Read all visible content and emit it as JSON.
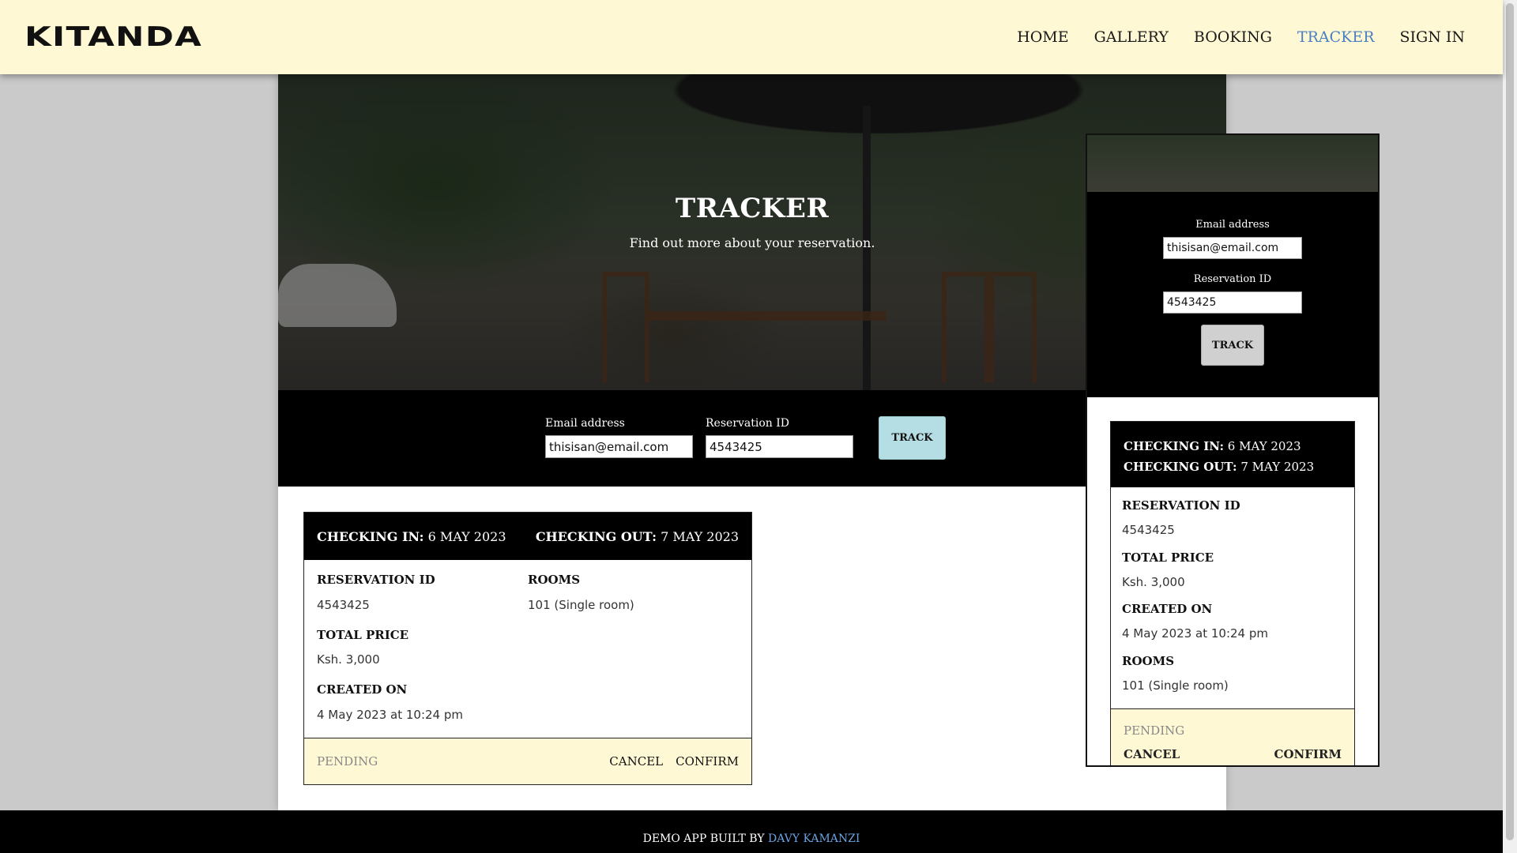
{
  "header": {
    "logo": "KITANDA",
    "nav": [
      {
        "label": "HOME",
        "active": false
      },
      {
        "label": "GALLERY",
        "active": false
      },
      {
        "label": "BOOKING",
        "active": false
      },
      {
        "label": "TRACKER",
        "active": true
      },
      {
        "label": "SIGN IN",
        "active": false
      }
    ],
    "active_color": "#4a7fc1"
  },
  "hero": {
    "title": "TRACKER",
    "subtitle": "Find out more about your reservation."
  },
  "search": {
    "email_label": "Email address",
    "email_value": "thisisan@email.com",
    "reservation_label": "Reservation ID",
    "reservation_value": "4543425",
    "track_label": "TRACK",
    "track_color": "#b4dee4"
  },
  "reservation": {
    "checking_in_label": "CHECKING IN:",
    "checking_in_value": "6 MAY 2023",
    "checking_out_label": "CHECKING OUT:",
    "checking_out_value": "7 MAY 2023",
    "reservation_id_label": "RESERVATION ID",
    "reservation_id_value": "4543425",
    "rooms_label": "ROOMS",
    "rooms_value": "101 (Single room)",
    "total_price_label": "TOTAL PRICE",
    "total_price_value": "Ksh. 3,000",
    "created_on_label": "CREATED ON",
    "created_on_value": "4 May 2023 at 10:24 pm",
    "status": "PENDING",
    "cancel_label": "CANCEL",
    "confirm_label": "CONFIRM",
    "footer_bg": "#fef9d4"
  },
  "footer": {
    "text": "DEMO APP BUILT BY",
    "author": "DAVY KAMANZI"
  }
}
